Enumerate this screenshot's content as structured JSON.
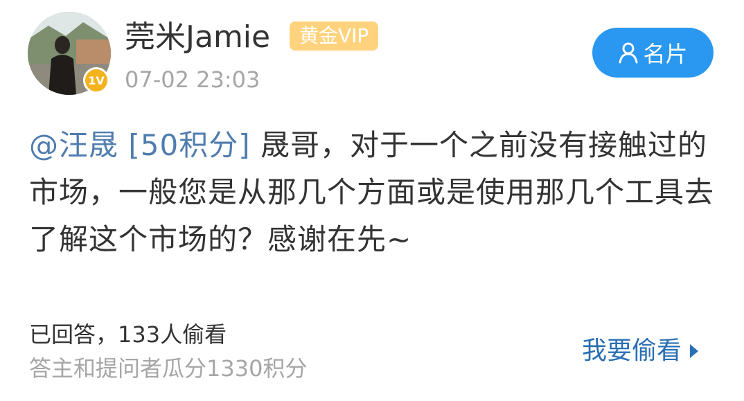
{
  "user": {
    "name": "莞米Jamie",
    "vip_label": "黄金VIP",
    "verified_level": "1V",
    "timestamp": "07-02 23:03"
  },
  "profile_button": {
    "label": "名片",
    "icon": "person-icon"
  },
  "question": {
    "mention": "@汪晟",
    "reward": "[50积分]",
    "body": " 晟哥，对于一个之前没有接触过的市场，一般您是从那几个方面或是使用那几个工具去了解这个市场的？感谢在先~"
  },
  "footer": {
    "answered_text": "已回答，133人偷看",
    "split_text": "答主和提问者瓜分1330积分",
    "peek_label": "我要偷看",
    "peek_icon": "triangle-right-icon"
  },
  "colors": {
    "link_blue": "#507daf",
    "button_blue": "#2a97f0",
    "vip_gold": "#ffd37d",
    "badge_orange": "#f4b21c",
    "muted_gray": "#a6a6a6",
    "text_dark": "#333333"
  }
}
